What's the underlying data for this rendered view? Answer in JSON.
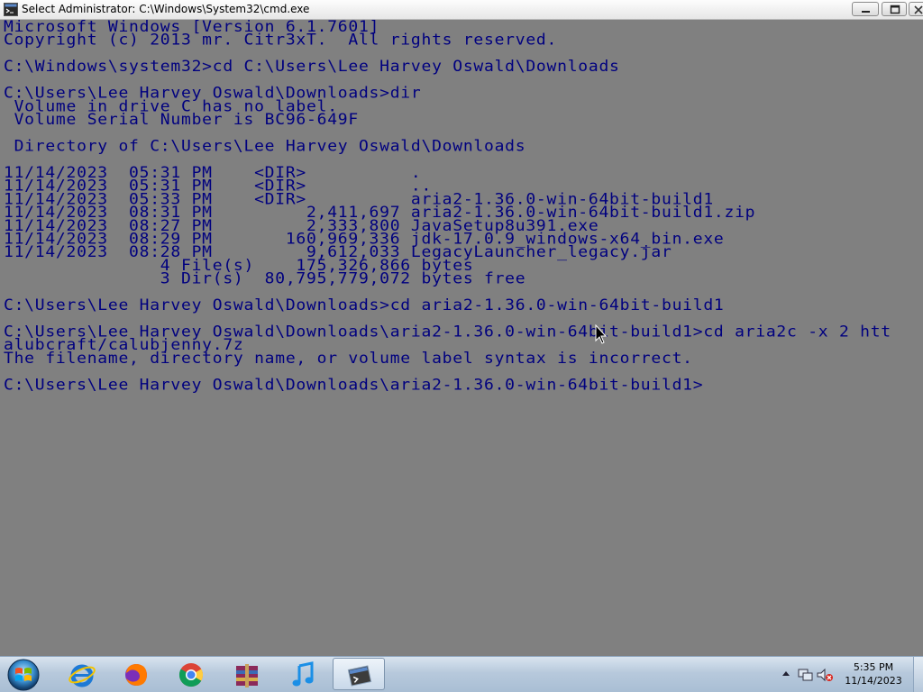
{
  "window": {
    "title": "Select Administrator: C:\\Windows\\System32\\cmd.exe",
    "icon": "cmd-icon",
    "controls": [
      "minimize",
      "maximize",
      "close"
    ]
  },
  "console": {
    "text_color": "#00007f",
    "background": "#808080",
    "lines": [
      "Microsoft Windows [Version 6.1.7601]",
      "Copyright (c) 2013 mr. Citr3xT.  All rights reserved.",
      "",
      "C:\\Windows\\system32>cd C:\\Users\\Lee Harvey Oswald\\Downloads",
      "",
      "C:\\Users\\Lee Harvey Oswald\\Downloads>dir",
      " Volume in drive C has no label.",
      " Volume Serial Number is BC96-649F",
      "",
      " Directory of C:\\Users\\Lee Harvey Oswald\\Downloads",
      "",
      "11/14/2023  05:31 PM    <DIR>          .",
      "11/14/2023  05:31 PM    <DIR>          ..",
      "11/14/2023  05:33 PM    <DIR>          aria2-1.36.0-win-64bit-build1",
      "11/14/2023  08:31 PM         2,411,697 aria2-1.36.0-win-64bit-build1.zip",
      "11/14/2023  08:27 PM         2,333,800 JavaSetup8u391.exe",
      "11/14/2023  08:29 PM       160,969,336 jdk-17.0.9_windows-x64_bin.exe",
      "11/14/2023  08:28 PM         9,612,033 LegacyLauncher_legacy.jar",
      "               4 File(s)    175,326,866 bytes",
      "               3 Dir(s)  80,795,779,072 bytes free",
      "",
      "C:\\Users\\Lee Harvey Oswald\\Downloads>cd aria2-1.36.0-win-64bit-build1",
      "",
      "C:\\Users\\Lee Harvey Oswald\\Downloads\\aria2-1.36.0-win-64bit-build1>cd aria2c -x 2 htt",
      "alubcraft/calubjenny.7z",
      "The filename, directory name, or volume label syntax is incorrect.",
      "",
      "C:\\Users\\Lee Harvey Oswald\\Downloads\\aria2-1.36.0-win-64bit-build1>"
    ]
  },
  "taskbar": {
    "start_icon": "windows-start-orb-icon",
    "pinned": [
      {
        "name": "internet-explorer-icon",
        "active": false
      },
      {
        "name": "firefox-icon",
        "active": false
      },
      {
        "name": "chrome-icon",
        "active": false
      },
      {
        "name": "winrar-icon",
        "active": false
      },
      {
        "name": "itunes-music-icon",
        "active": false
      },
      {
        "name": "cmd-window-icon",
        "active": true
      }
    ],
    "clock": {
      "time": "5:35 PM",
      "date": "11/14/2023"
    }
  }
}
